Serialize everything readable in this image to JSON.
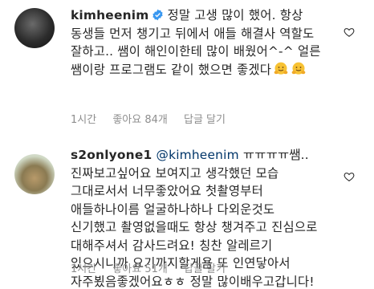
{
  "comments": [
    {
      "username": "kimheenim",
      "verified": true,
      "lines": [
        "정말 고생 많이 했어. 항상",
        "동생들 먼저 챙기고 뒤에서 애들 해결사 역할도",
        "잘하고.. 쌤이 해인이한테 많이 배웠어^-^ 얼른",
        "쌤이랑 프로그램도 같이 했으면 좋겠다"
      ],
      "time": "1시간",
      "likes": "좋아요 84개",
      "reply": "답글 달기"
    },
    {
      "username": "s2onlyone1",
      "mention": "@kimheenim",
      "first_line_rest": "ㅠㅠㅠㅠ쌤..",
      "lines": [
        "진짜보고싶어요 보여지고 생각했던 모습",
        "그대로서서 너무좋았어요 첫촬영부터",
        "애들하나이름 얼굴하나하나 다외운것도",
        "신기했고 촬영없을때도 항상 챙겨주고 진심으로",
        "대해주셔서 감사드려요! 칭찬 알레르기",
        "있으시니까 요기까지할게욤 또 인연닿아서",
        "자주뵜음좋겠어요ㅎㅎ 정말 많이배우고갑니다!"
      ],
      "time": "1시간",
      "likes": "좋아요 51개",
      "reply": "답글 달기"
    }
  ]
}
